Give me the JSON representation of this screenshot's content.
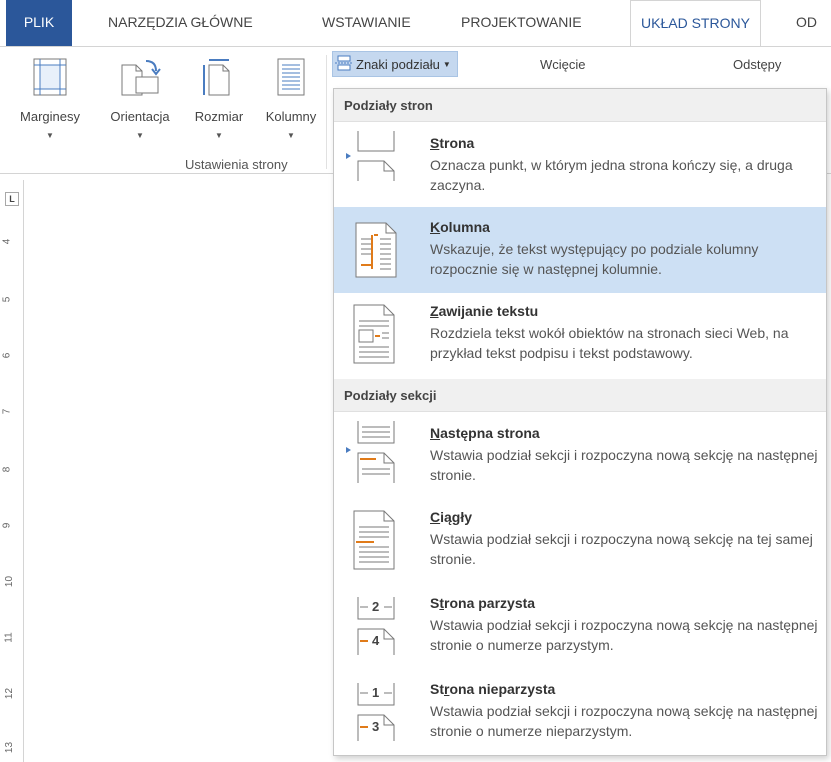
{
  "tabs": [
    {
      "label": "PLIK"
    },
    {
      "label": "NARZĘDZIA GŁÓWNE"
    },
    {
      "label": "WSTAWIANIE"
    },
    {
      "label": "PROJEKTOWANIE"
    },
    {
      "label": "UKŁAD STRONY"
    },
    {
      "label": "OD"
    }
  ],
  "ribbon": {
    "buttons": [
      {
        "label": "Marginesy",
        "icon": "margins-icon"
      },
      {
        "label": "Orientacja",
        "icon": "orientation-icon"
      },
      {
        "label": "Rozmiar",
        "icon": "size-icon"
      },
      {
        "label": "Kolumny",
        "icon": "columns-icon"
      }
    ],
    "group_label": "Ustawienia strony",
    "breaks_label": "Znaki podziału",
    "indent_label": "Wcięcie",
    "spacing_label": "Odstępy"
  },
  "ruler": {
    "corner": "L",
    "numbers": [
      "4",
      "5",
      "6",
      "7",
      "8",
      "9",
      "10",
      "11",
      "12",
      "13"
    ]
  },
  "menu": {
    "page_breaks_header": "Podziały stron",
    "section_breaks_header": "Podziały sekcji",
    "page_items": [
      {
        "key": "S",
        "rest": "trona",
        "desc": "Oznacza punkt, w którym jedna strona kończy się, a druga zaczyna.",
        "icon": "page-break-icon"
      },
      {
        "key": "K",
        "rest": "olumna",
        "desc": "Wskazuje, że tekst występujący po podziale kolumny rozpocznie się w następnej kolumnie.",
        "icon": "column-break-icon"
      },
      {
        "key": "Z",
        "rest": "awijanie tekstu",
        "desc": "Rozdziela tekst wokół obiektów na stronach sieci Web, na przykład tekst podpisu i tekst podstawowy.",
        "icon": "text-wrapping-icon"
      }
    ],
    "section_items": [
      {
        "key": "N",
        "rest": "astępna strona",
        "desc": "Wstawia podział sekcji i rozpoczyna nową sekcję na następnej stronie.",
        "icon": "next-page-icon"
      },
      {
        "key": "C",
        "rest": "iągły",
        "desc": "Wstawia podział sekcji i rozpoczyna nową sekcję na tej samej stronie.",
        "icon": "continuous-icon"
      },
      {
        "pre": "S",
        "key": "t",
        "rest": "rona parzysta",
        "desc": "Wstawia podział sekcji i rozpoczyna nową sekcję na następnej stronie o numerze parzystym.",
        "icon": "even-page-icon",
        "n1": "2",
        "n2": "4"
      },
      {
        "pre": "St",
        "key": "r",
        "rest": "ona nieparzysta",
        "desc": "Wstawia podział sekcji i rozpoczyna nową sekcję na następnej stronie o numerze nieparzystym.",
        "icon": "odd-page-icon",
        "n1": "1",
        "n2": "3"
      }
    ]
  },
  "colors": {
    "file_tab": "#2b579a",
    "highlight": "#cde0f4",
    "accent_orange": "#e07b1a"
  }
}
